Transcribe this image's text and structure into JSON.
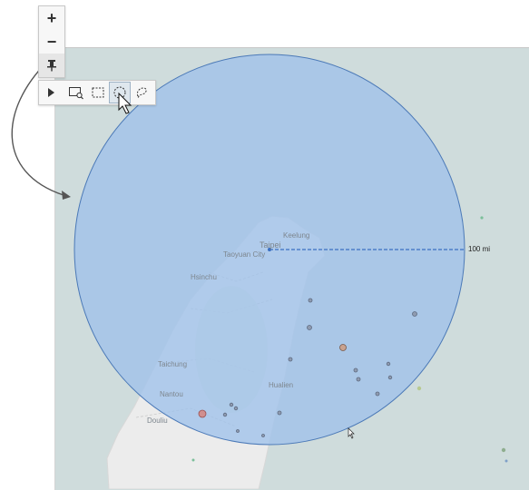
{
  "map_controls": {
    "zoom_in": "+",
    "zoom_out": "−",
    "pin_icon": "pin-icon",
    "expand_icon": "play-triangle-icon"
  },
  "selection_tools": [
    {
      "name": "radial-select-tool",
      "icon": "rectangle-with-magnifier-icon"
    },
    {
      "name": "rectangle-select-tool",
      "icon": "dashed-rectangle-icon"
    },
    {
      "name": "circle-select-tool",
      "icon": "dashed-circle-icon",
      "active": true
    },
    {
      "name": "lasso-select-tool",
      "icon": "lasso-icon"
    }
  ],
  "map_labels": {
    "taipei": "Taipei",
    "taoyuan": "Taoyuan City",
    "keelung": "Keelung",
    "hsinchu": "Hsinchu",
    "taichung": "Taichung",
    "hualien": "Hualien",
    "nantou": "Nantou",
    "douliu": "Douliu"
  },
  "radius_measure": "100 mi",
  "colors": {
    "selection_fill": "#9fc2ea",
    "selection_stroke": "#4b79b7",
    "land": "#ececec",
    "sea": "#cfdcdc"
  }
}
